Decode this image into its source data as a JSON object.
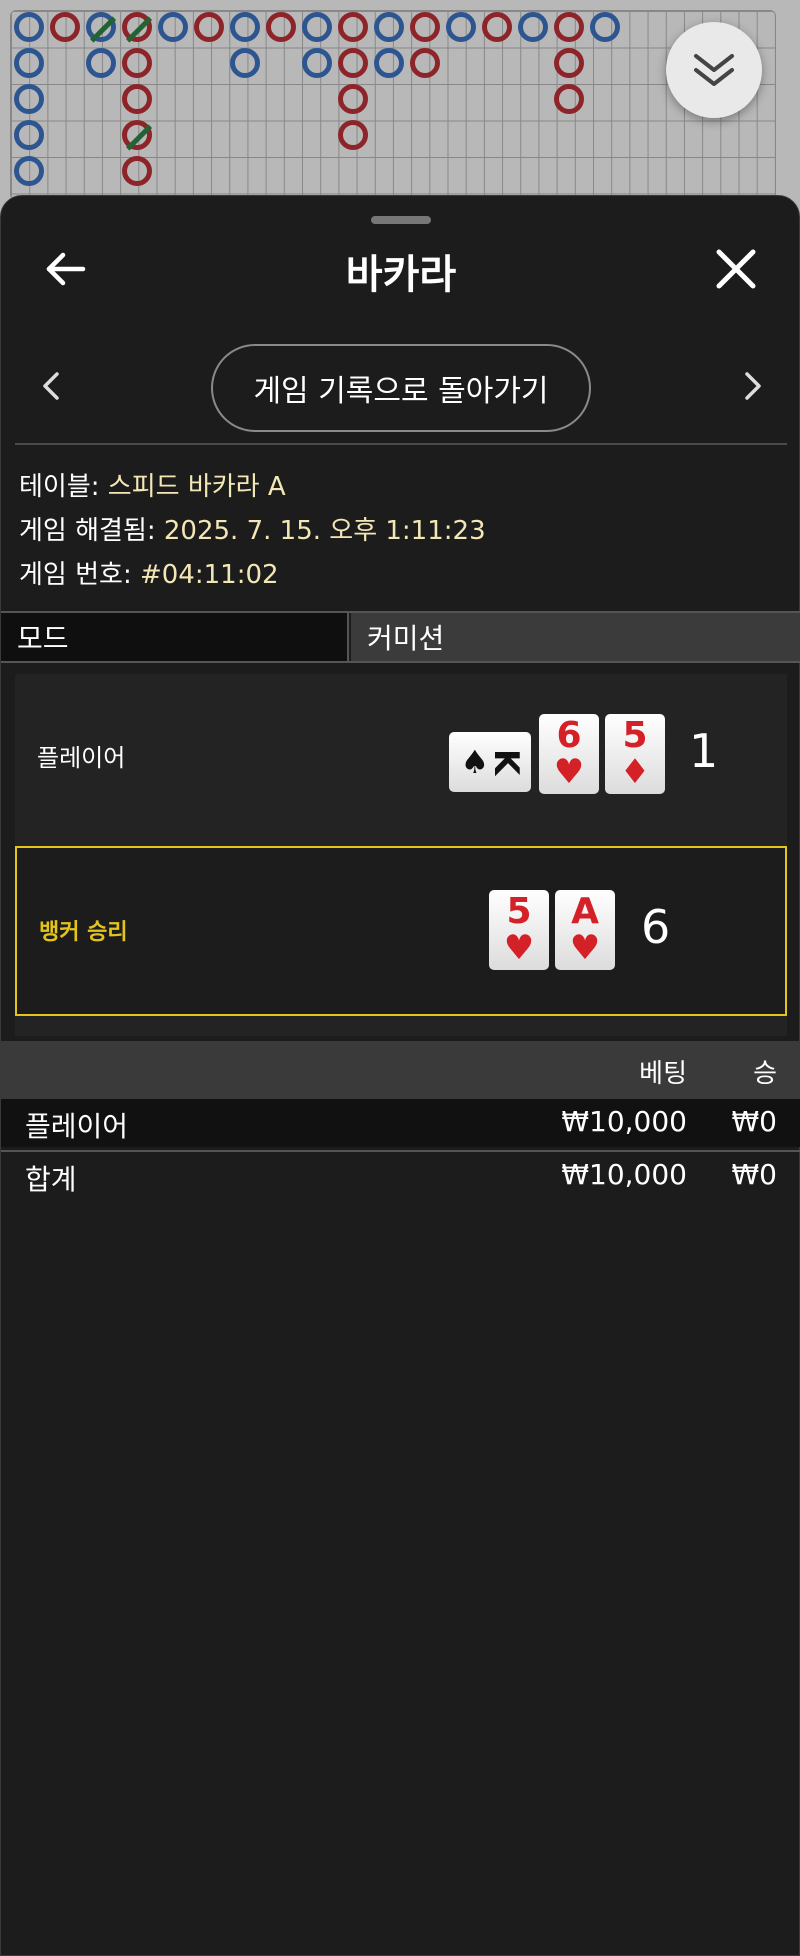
{
  "header": {
    "title": "바카라",
    "back_label": "게임 기록으로 돌아가기"
  },
  "info": {
    "table_label": "테이블:",
    "table_value": "스피드 바카라 A",
    "resolved_label": "게임 해결됨:",
    "resolved_value": "2025. 7. 15. 오후 1:11:23",
    "game_no_label": "게임 번호:",
    "game_no_value": "#04:11:02"
  },
  "tabs": {
    "mode": "모드",
    "commission": "커미션"
  },
  "player": {
    "label": "플레이어",
    "cards": [
      {
        "rank": "K",
        "suit": "♠"
      },
      {
        "rank": "6",
        "suit": "♥"
      },
      {
        "rank": "5",
        "suit": "♦"
      }
    ],
    "score": "1"
  },
  "banker": {
    "label": "뱅커 승리",
    "cards": [
      {
        "rank": "5",
        "suit": "♥"
      },
      {
        "rank": "A",
        "suit": "♥"
      }
    ],
    "score": "6"
  },
  "table": {
    "headers": {
      "bet": "베팅",
      "win": "승"
    },
    "rows": [
      {
        "name": "플레이어",
        "bet": "₩10,000",
        "win": "₩0"
      },
      {
        "name": "합계",
        "bet": "₩10,000",
        "win": "₩0"
      }
    ]
  },
  "road": {
    "colors": {
      "player": "#3f78c9",
      "banker": "#c4323a",
      "tie": "#2f8a46",
      "accent": "#e3c41c"
    }
  }
}
